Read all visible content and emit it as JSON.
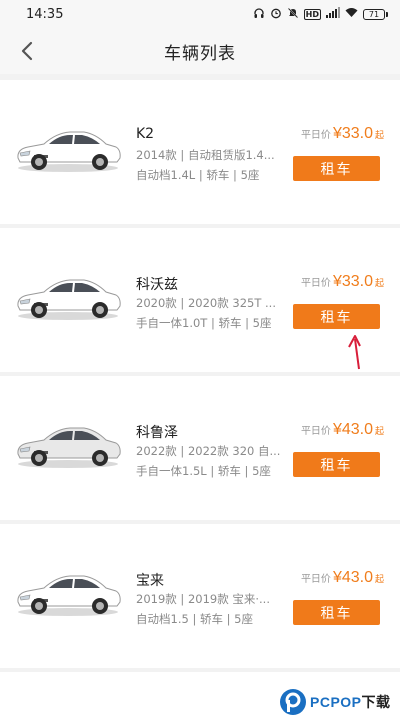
{
  "status_bar": {
    "time": "14:35",
    "battery": "71",
    "hd": "HD"
  },
  "header": {
    "title": "车辆列表",
    "back_icon": "chevron-left-icon"
  },
  "price_label": "平日价",
  "price_suffix": "起",
  "cars": [
    {
      "name": "K2",
      "spec": "2014款 | 自动租赁版1.4...",
      "attrs": "自动档1.4L | 轿车 | 5座",
      "price": "¥33.0",
      "button": "租车",
      "color": "#ffffff"
    },
    {
      "name": "科沃兹",
      "spec": "2020款 | 2020款 325T ...",
      "attrs": "手自一体1.0T | 轿车 | 5座",
      "price": "¥33.0",
      "button": "租车",
      "color": "#ffffff"
    },
    {
      "name": "科鲁泽",
      "spec": "2022款 | 2022款 320 自...",
      "attrs": "手自一体1.5L | 轿车 | 5座",
      "price": "¥43.0",
      "button": "租车",
      "color": "#e8e8e8"
    },
    {
      "name": "宝来",
      "spec": "2019款 | 2019款 宝来·...",
      "attrs": "自动档1.5 | 轿车 | 5座",
      "price": "¥43.0",
      "button": "租车",
      "color": "#ffffff"
    }
  ],
  "accent_color": "#f07a1a",
  "annotation_arrow_color": "#d81e3a",
  "watermark": {
    "brand": "PCPOP",
    "suffix": "下载"
  }
}
